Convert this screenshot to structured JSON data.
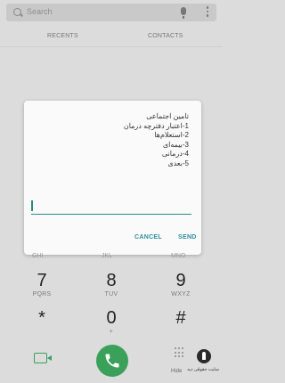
{
  "search": {
    "placeholder": "Search"
  },
  "tabs": {
    "recents": "RECENTS",
    "contacts": "CONTACTS"
  },
  "dialog": {
    "lines": [
      "تامین اجتماعی",
      "1-اعتبار دفترچه درمان",
      "2-استعلام‌ها",
      "3-بیمه‌ای",
      "4-درمانی",
      "5-بعدی"
    ],
    "input_value": "",
    "cancel_label": "CANCEL",
    "send_label": "SEND"
  },
  "keypad": {
    "partial": {
      "k4": "GHI",
      "k5": "JKL",
      "k6": "MNO"
    },
    "keys": [
      {
        "digit": "7",
        "letters": "PQRS"
      },
      {
        "digit": "8",
        "letters": "TUV"
      },
      {
        "digit": "9",
        "letters": "WXYZ"
      },
      {
        "digit": "*",
        "letters": ""
      },
      {
        "digit": "0",
        "letters": "+"
      },
      {
        "digit": "#",
        "letters": ""
      }
    ]
  },
  "bottom": {
    "hide_label": "Hide"
  },
  "watermark": {
    "text": "سایت حقوقی دیه"
  },
  "colors": {
    "accent": "#2f8e9e",
    "call_green": "#3aa05a"
  },
  "icons": [
    "search-icon",
    "mic-icon",
    "more-icon",
    "video-call-icon",
    "phone-icon",
    "dialpad-icon"
  ]
}
